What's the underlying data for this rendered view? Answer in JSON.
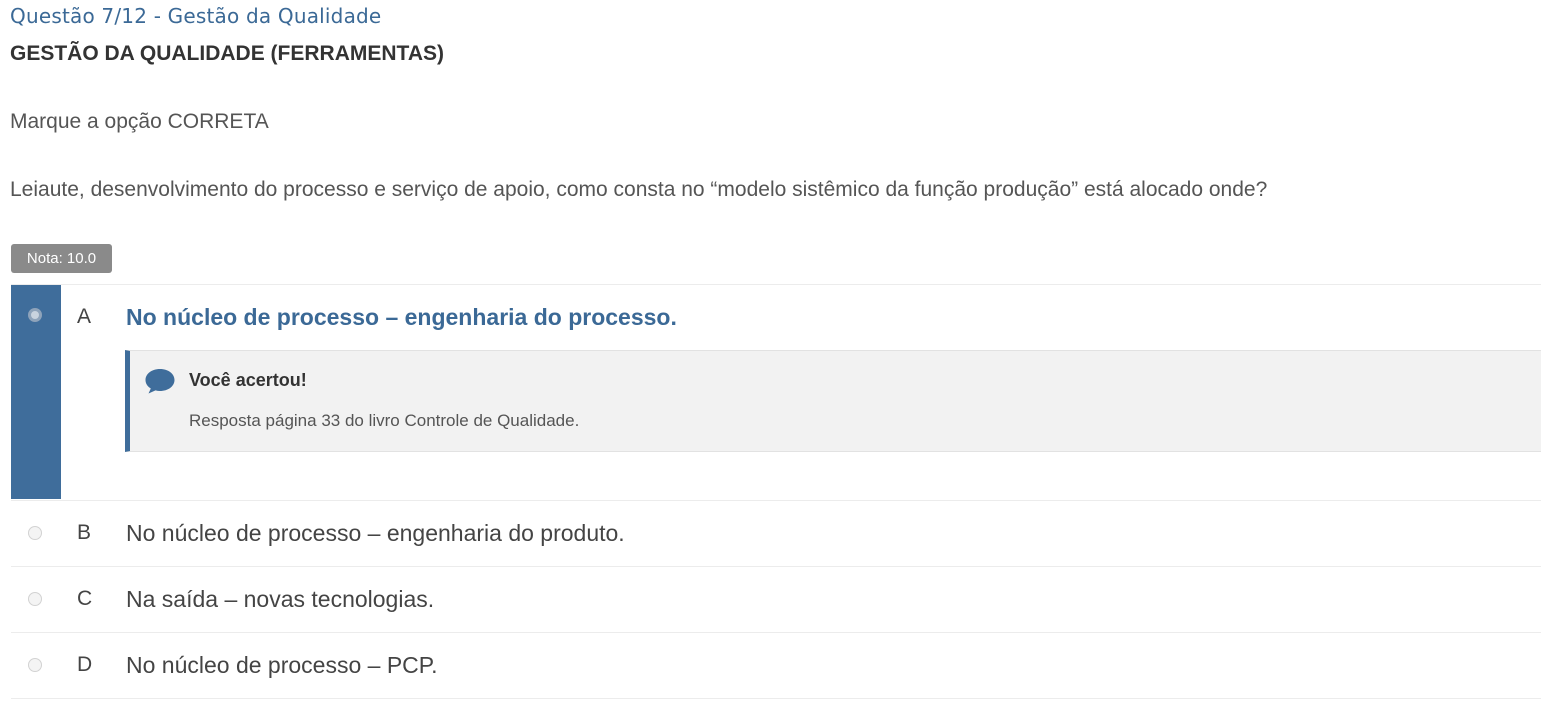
{
  "question": {
    "header": "Questão 7/12 - Gestão da Qualidade",
    "subject": "GESTÃO DA QUALIDADE (FERRAMENTAS)",
    "instruction": "Marque a opção CORRETA",
    "statement": "Leiaute, desenvolvimento do processo e serviço de apoio, como consta no “modelo sistêmico da função produção” está alocado onde?",
    "score": "Nota: 10.0"
  },
  "options": [
    {
      "letter": "A",
      "text": "No núcleo de processo – engenharia do processo.",
      "selected": true
    },
    {
      "letter": "B",
      "text": "No núcleo de processo – engenharia do produto.",
      "selected": false
    },
    {
      "letter": "C",
      "text": "Na saída – novas tecnologias.",
      "selected": false
    },
    {
      "letter": "D",
      "text": "No núcleo de processo – PCP.",
      "selected": false
    }
  ],
  "feedback": {
    "icon": "comment-icon",
    "title": "Você acertou!",
    "text": "Resposta página 33 do livro Controle de Qualidade."
  },
  "colors": {
    "accent": "#3f6d9b",
    "header_text": "#3b6996",
    "badge": "#8a8a8a",
    "feedback_bg": "#f2f2f2"
  }
}
